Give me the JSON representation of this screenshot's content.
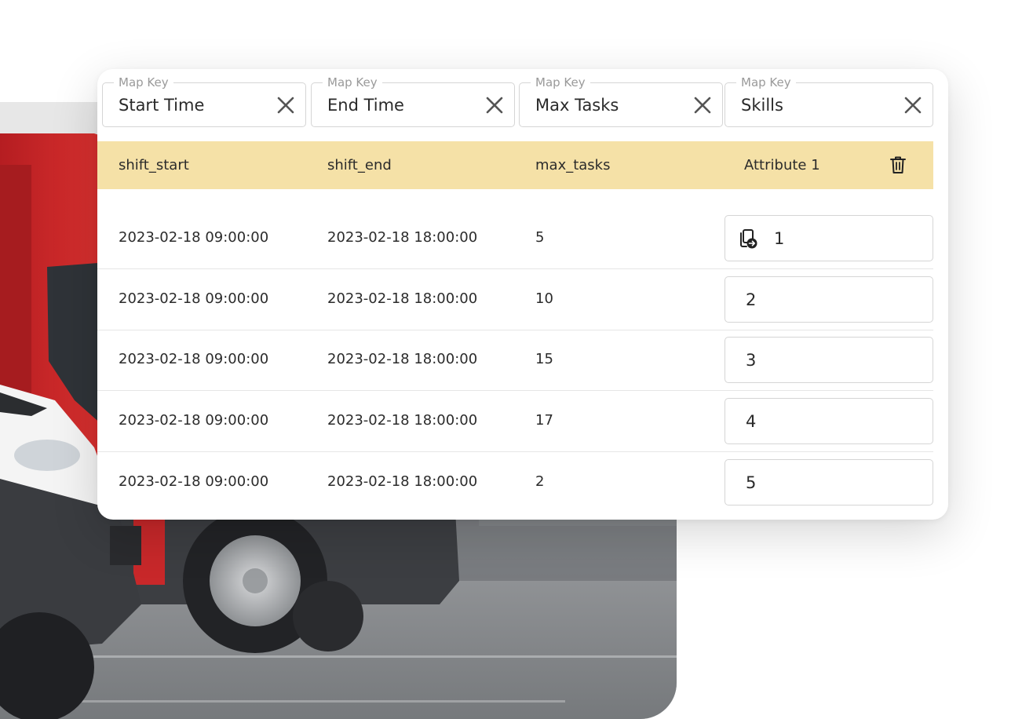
{
  "map_keys": {
    "legend": "Map Key",
    "fields": [
      {
        "value": "Start Time"
      },
      {
        "value": "End Time"
      },
      {
        "value": "Max Tasks"
      },
      {
        "value": "Skills"
      }
    ]
  },
  "table": {
    "headers": [
      "shift_start",
      "shift_end",
      "max_tasks",
      "Attribute 1"
    ],
    "rows": [
      {
        "shift_start": "2023-02-18 09:00:00",
        "shift_end": "2023-02-18 18:00:00",
        "max_tasks": "5",
        "attribute": "1"
      },
      {
        "shift_start": "2023-02-18 09:00:00",
        "shift_end": "2023-02-18 18:00:00",
        "max_tasks": "10",
        "attribute": "2"
      },
      {
        "shift_start": "2023-02-18 09:00:00",
        "shift_end": "2023-02-18 18:00:00",
        "max_tasks": "15",
        "attribute": "3"
      },
      {
        "shift_start": "2023-02-18 09:00:00",
        "shift_end": "2023-02-18 18:00:00",
        "max_tasks": "17",
        "attribute": "4"
      },
      {
        "shift_start": "2023-02-18 09:00:00",
        "shift_end": "2023-02-18 18:00:00",
        "max_tasks": "2",
        "attribute": "5"
      }
    ]
  },
  "icons": {
    "clear": "close-icon",
    "delete_column": "trash-icon",
    "copy": "copy-to-icon"
  },
  "colors": {
    "header_bg": "#f5e1a7",
    "border": "#d5d5d5",
    "van_red": "#c8282a"
  }
}
